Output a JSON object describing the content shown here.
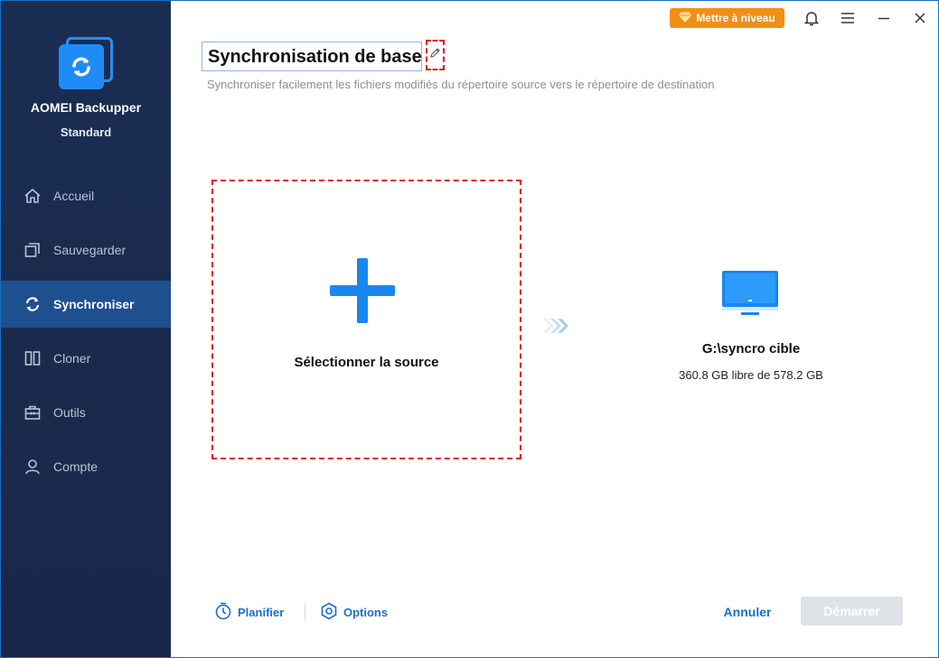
{
  "app": {
    "name": "AOMEI Backupper",
    "edition": "Standard"
  },
  "sidebar": {
    "items": [
      {
        "label": "Accueil",
        "icon": "home-icon",
        "active": false
      },
      {
        "label": "Sauvegarder",
        "icon": "backup-icon",
        "active": false
      },
      {
        "label": "Synchroniser",
        "icon": "sync-icon",
        "active": true
      },
      {
        "label": "Cloner",
        "icon": "clone-icon",
        "active": false
      },
      {
        "label": "Outils",
        "icon": "toolbox-icon",
        "active": false
      },
      {
        "label": "Compte",
        "icon": "user-icon",
        "active": false
      }
    ]
  },
  "topbar": {
    "upgrade_label": "Mettre à niveau",
    "icons": [
      "diamond-icon",
      "bell-icon",
      "menu-icon",
      "minimize-icon",
      "close-icon"
    ]
  },
  "main": {
    "task_name": "Synchronisation de base",
    "subtitle": "Synchroniser facilement les fichiers modifiés du répertoire source vers le répertoire de destination",
    "source_label": "Sélectionner la source",
    "destination": {
      "name": "G:\\syncro cible",
      "info": "360.8 GB libre de 578.2 GB"
    }
  },
  "footer": {
    "schedule_label": "Planifier",
    "options_label": "Options",
    "cancel_label": "Annuler",
    "start_label": "Démarrer"
  },
  "colors": {
    "sidebar_bg": "#1a2d52",
    "active_nav": "#1e4f8f",
    "accent": "#1a86f0",
    "upgrade": "#f08f17",
    "dashed_highlight": "#e0141c",
    "start_disabled": "#dfe3e8"
  }
}
